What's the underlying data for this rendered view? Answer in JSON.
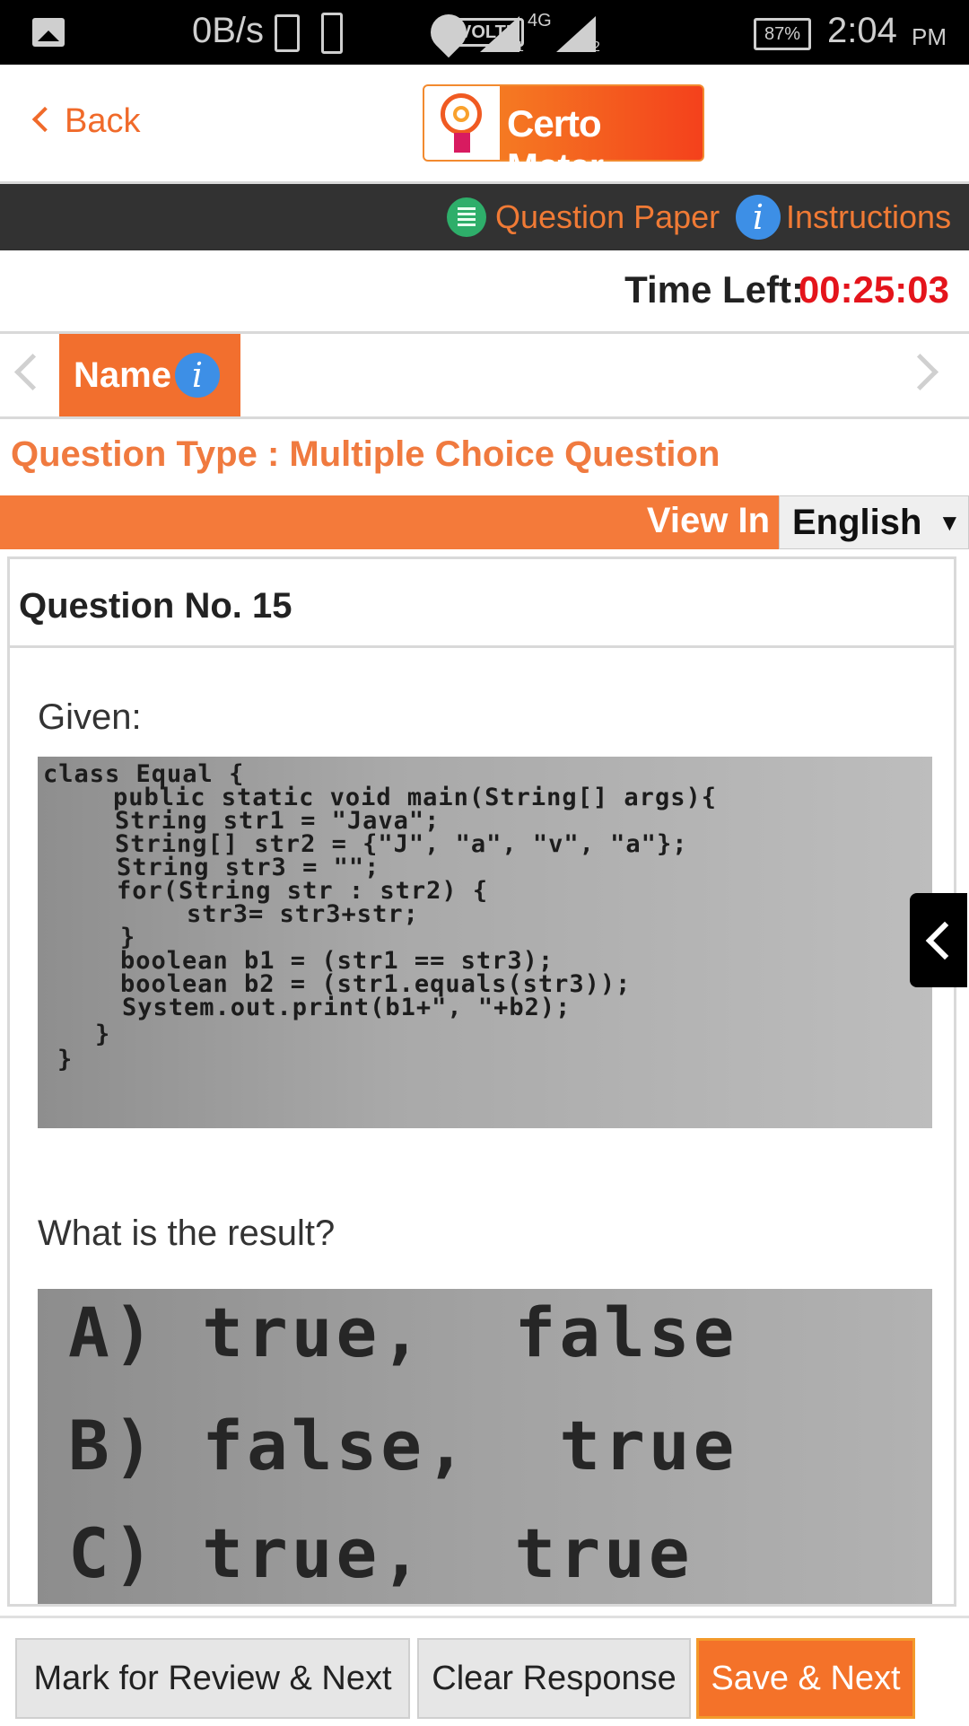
{
  "status_bar": {
    "net_speed": "0B/s",
    "volte": "VOLTE",
    "network": "4G",
    "sim1": "1",
    "sim2": "2",
    "battery": "87%",
    "time": "2:04",
    "ampm": "PM"
  },
  "header": {
    "back_label": "Back",
    "logo_text": "Certo Meter"
  },
  "toolbar": {
    "question_paper": "Question Paper",
    "instructions": "Instructions",
    "info_glyph": "i"
  },
  "timer": {
    "label": "Time Left:",
    "value": "00:25:03"
  },
  "section": {
    "tab_label": "Name",
    "info_glyph": "i"
  },
  "question_type": "Question Type : Multiple Choice Question",
  "view_bar": {
    "label": "View In",
    "language": "English",
    "caret": "▼"
  },
  "question": {
    "number_label": "Question No. 15",
    "given": "Given:",
    "code_lines": [
      "class Equal {",
      "public static void main(String[] args){",
      "String str1 = \"Java\";",
      "String[] str2 = {\"J\", \"a\", \"v\", \"a\"};",
      "String str3 = \"\";",
      "for(String str : str2) {",
      "str3= str3+str;",
      "}",
      "boolean b1 = (str1 == str3);",
      "boolean b2 = (str1.equals(str3));",
      "System.out.print(b1+\", \"+b2);",
      "}",
      "}"
    ],
    "prompt": "What is the result?",
    "options": [
      "A) true,  false",
      "B) false,  true",
      "C) true,  true"
    ]
  },
  "actions": {
    "mark_review": "Mark for Review & Next",
    "clear": "Clear Response",
    "save": "Save & Next"
  },
  "colors": {
    "accent": "#f26f2e",
    "timer": "#e4141b",
    "toolbar_bg": "#323232",
    "info_blue": "#3d8fe6"
  },
  "icons": [
    "gallery-icon",
    "vibrate-icon",
    "wifi-icon",
    "signal-icon",
    "battery-icon",
    "back-chevron-icon",
    "question-paper-icon",
    "info-icon",
    "prev-arrow-icon",
    "next-arrow-icon",
    "dropdown-caret-icon",
    "collapse-chevron-icon"
  ]
}
